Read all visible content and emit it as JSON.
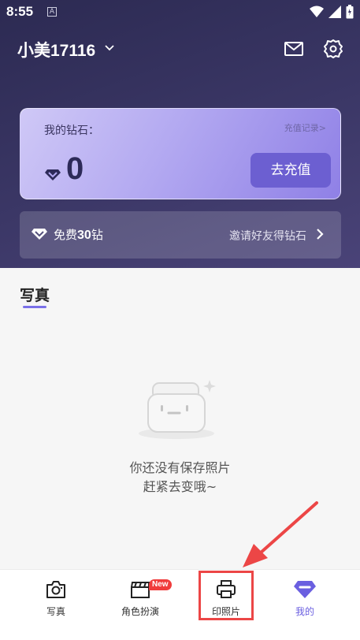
{
  "status_bar": {
    "time": "8:55",
    "app_icon_letter": "A"
  },
  "header": {
    "user_name": "小美17116",
    "icons": [
      "chevron-down-icon",
      "mail-icon",
      "gear-icon"
    ]
  },
  "diamond_card": {
    "title": "我的钻石：",
    "record_link": "充值记录>",
    "count": "0",
    "recharge_label": "去充值"
  },
  "free_bar": {
    "prefix": "免费",
    "amount": "30",
    "suffix": "钻",
    "invite_label": "邀请好友得钻石"
  },
  "content": {
    "tab_label": "写真",
    "empty_line1": "你还没有保存照片",
    "empty_line2": "赶紧去变哦~"
  },
  "bottom_nav": {
    "items": [
      {
        "label": "写真",
        "icon": "camera-icon"
      },
      {
        "label": "角色扮演",
        "icon": "clapperboard-icon",
        "badge": "New"
      },
      {
        "label": "印照片",
        "icon": "printer-icon"
      },
      {
        "label": "我的",
        "icon": "diamond-icon",
        "active": true
      }
    ]
  },
  "colors": {
    "accent": "#6a5fe0",
    "header_bg": "#3b3766",
    "highlight": "#ec4646"
  }
}
